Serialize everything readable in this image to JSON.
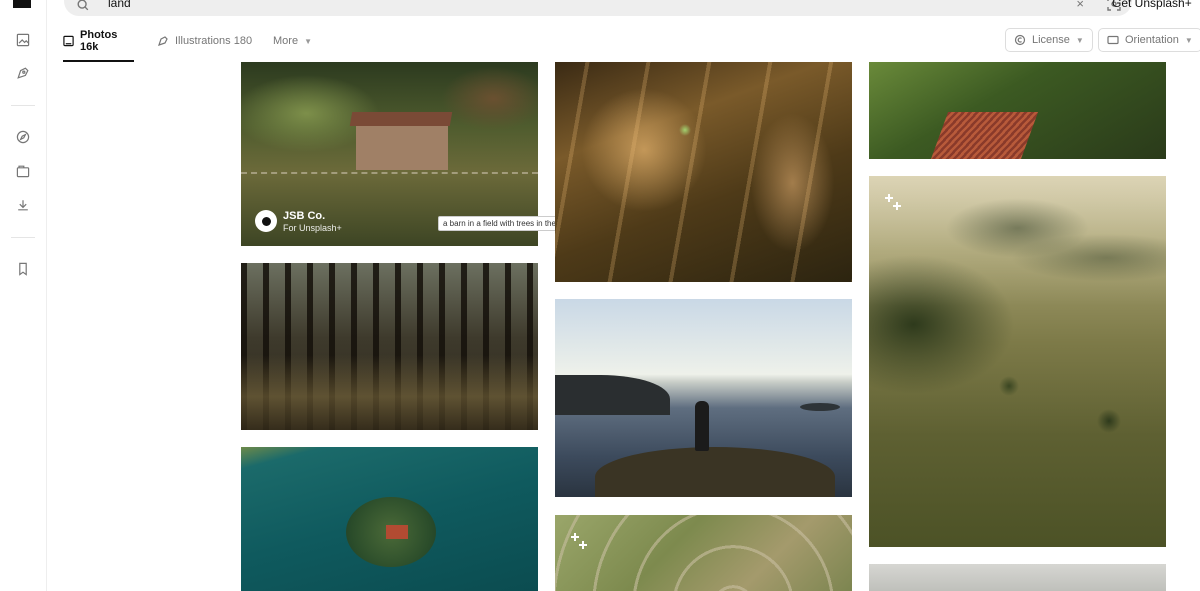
{
  "search": {
    "query": "land",
    "clear_glyph": "×"
  },
  "header": {
    "cta_label": "Get Unsplash+"
  },
  "tabs": [
    {
      "label": "Photos",
      "count": "16k",
      "icon": "image-icon",
      "active": true
    },
    {
      "label": "Illustrations",
      "count": "180",
      "icon": "pen-tool-icon",
      "active": false
    },
    {
      "label": "More",
      "icon": "chevron-down-icon",
      "active": false
    }
  ],
  "filters": {
    "license_label": "License",
    "orientation_label": "Orientation"
  },
  "sidebar": {
    "icons": [
      "unsplash-logo",
      "image-icon",
      "pen-tool-icon",
      "compass-icon",
      "collections-icon",
      "download-icon",
      "bookmark-icon"
    ]
  },
  "photos": [
    {
      "alt": "a barn in a field with trees in the background",
      "author": "JSB Co.",
      "author_sub": "For Unsplash+",
      "tooltip": "a barn in a field with trees in the background"
    },
    {
      "alt": "pine forest with sunlight on the ground"
    },
    {
      "alt": "small island with a house in turquoise lake"
    },
    {
      "alt": "golden grass stalks backlit by sunset"
    },
    {
      "alt": "person standing on a cliff overlooking the sea"
    },
    {
      "alt": "aerial view of winding river through green fields"
    },
    {
      "alt": "aerial view of farmland and trees"
    },
    {
      "alt": "misty aerial landscape with forest and fields",
      "badge": "unsplash-plus-icon"
    },
    {
      "alt": "foggy landscape"
    }
  ],
  "colors": {
    "accent": "#111111",
    "muted": "#767676",
    "search_bg": "#eeeeee"
  }
}
